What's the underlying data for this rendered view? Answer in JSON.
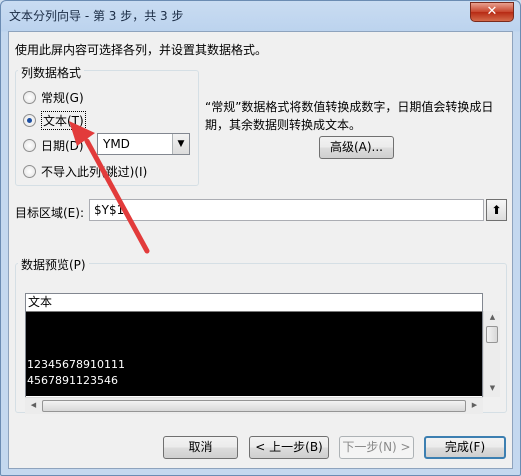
{
  "window": {
    "title": "文本分列向导 - 第 3 步，共 3 步",
    "close_glyph": "✕"
  },
  "instruction": "使用此屏内容可选择各列，并设置其数据格式。",
  "column_format": {
    "legend": "列数据格式",
    "options": [
      {
        "label": "常规(G)",
        "checked": false
      },
      {
        "label": "文本(T)",
        "checked": true
      },
      {
        "label": "日期(D)",
        "checked": false
      },
      {
        "label": "不导入此列(跳过)(I)",
        "checked": false
      }
    ],
    "date_select": {
      "value": "YMD",
      "arrow_glyph": "▼"
    }
  },
  "description": "“常规”数据格式将数值转换成数字，日期值会转换成日期，其余数据则转换成文本。",
  "advanced_button": "高级(A)...",
  "target": {
    "label": "目标区域(E):",
    "value": "$Y$1",
    "collapse_glyph": "⬆"
  },
  "preview": {
    "legend": "数据预览(P)",
    "header": "文本",
    "lines": [
      "12345678910111",
      "4567891123546"
    ],
    "up_glyph": "▲",
    "down_glyph": "▼",
    "left_glyph": "◀",
    "right_glyph": "▶"
  },
  "buttons": {
    "cancel": "取消",
    "back": "< 上一步(B)",
    "next": "下一步(N) >",
    "finish": "完成(F)"
  },
  "colors": {
    "annotation_arrow": "#e23b3b"
  }
}
